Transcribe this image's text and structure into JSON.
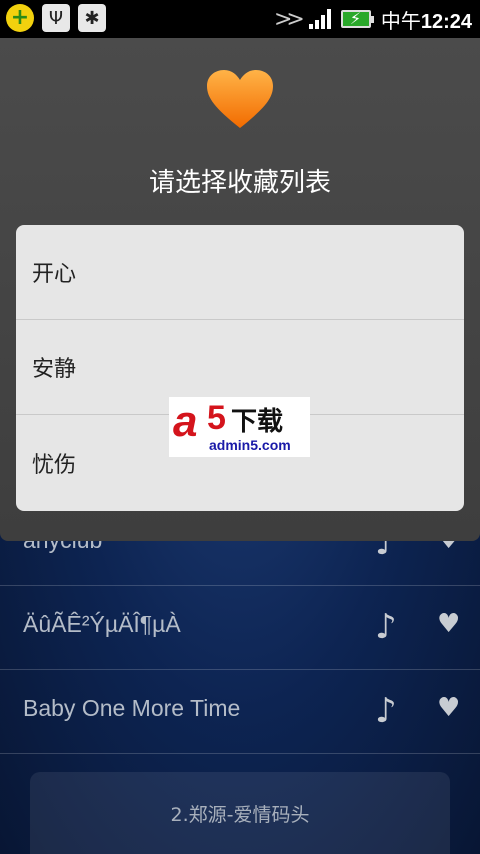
{
  "status_bar": {
    "time_prefix": "中午",
    "time": "12:24",
    "left_icons": [
      "plus-app-icon",
      "usb-icon",
      "bug-icon"
    ],
    "right_icons": [
      "data-transfer-icon",
      "signal-icon",
      "battery-charging-icon"
    ]
  },
  "dialog": {
    "title": "请选择收藏列表",
    "options": [
      {
        "label": "开心"
      },
      {
        "label": "安静"
      },
      {
        "label": "忧伤"
      }
    ]
  },
  "song_list": [
    {
      "title": "anyclub"
    },
    {
      "title": "ÄûÃÊ²ÝµÄÎ¶µÀ"
    },
    {
      "title": "Baby One More Time"
    }
  ],
  "now_playing": "2.郑源-爱情码头",
  "watermark": {
    "brand_a": "a",
    "brand_5": "5",
    "brand_cn": "下载",
    "url": "admin5.com"
  },
  "colors": {
    "heart": "#ff8a1c",
    "dialog_bg": "#454545",
    "options_bg": "#e6e6e6",
    "list_bg": "#0d2452"
  }
}
